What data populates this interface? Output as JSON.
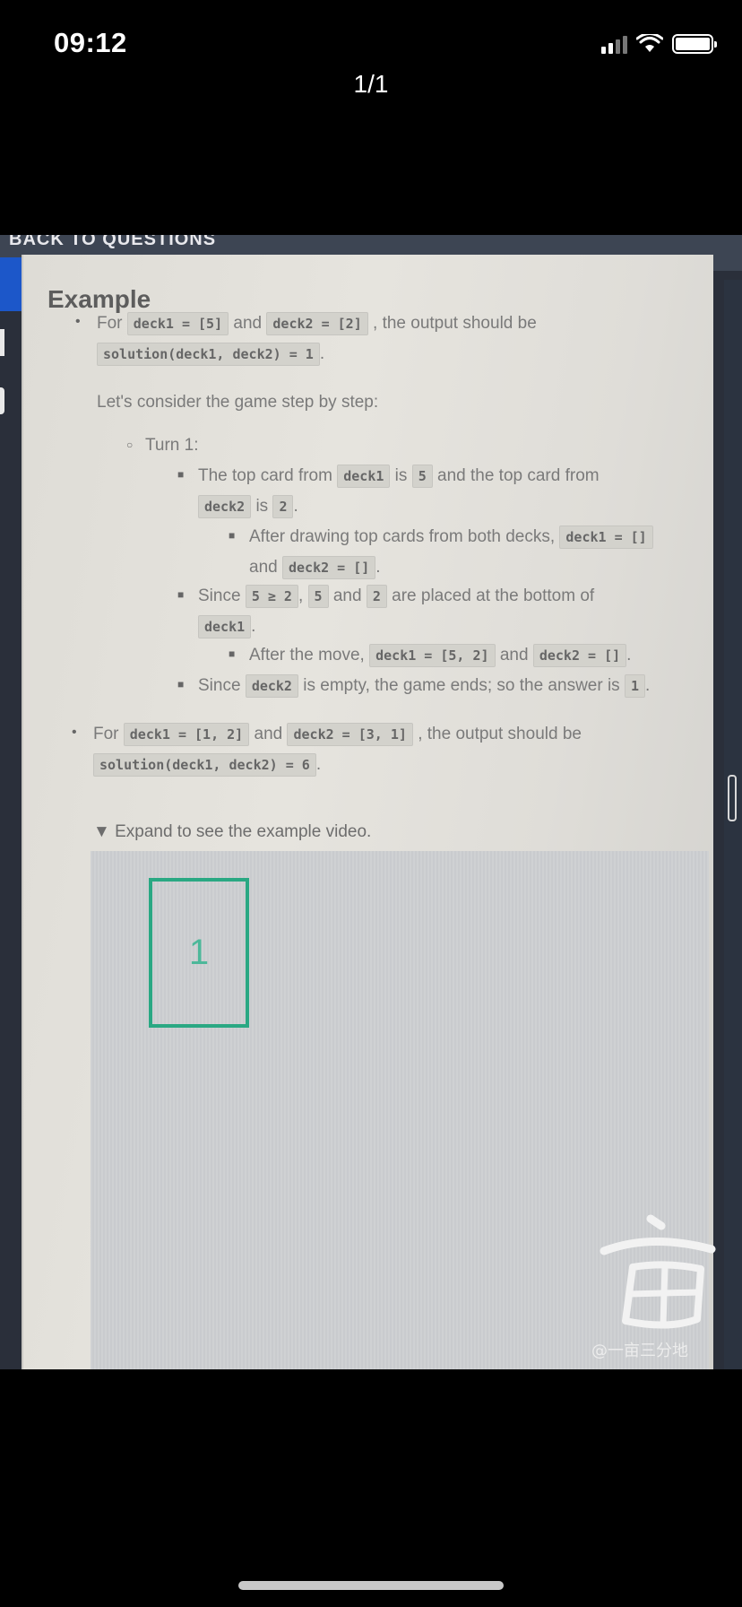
{
  "status_bar": {
    "time": "09:12"
  },
  "viewer": {
    "page_counter": "1/1"
  },
  "section": {
    "cut_heading": "BACK TO QUESTIONS"
  },
  "example": {
    "heading": "Example",
    "ex1": {
      "for": "For",
      "deck1_code": "deck1 = [5]",
      "and": "and",
      "deck2_code": "deck2 = [2]",
      "output_text": ", the output should be",
      "solution_code": "solution(deck1, deck2) = 1",
      "period": "."
    },
    "intro": "Let's consider the game step by step:",
    "turn_label": "Turn 1:",
    "step1": {
      "text_a": "The top card from",
      "deck1": "deck1",
      "is1": "is",
      "val5": "5",
      "text_b": "and the top card from",
      "deck2": "deck2",
      "is2": "is",
      "val2": "2",
      "period": "."
    },
    "step1_sub": {
      "text": "After drawing top cards from both decks,",
      "deck1_empty": "deck1 = []",
      "and": "and",
      "deck2_empty": "deck2 = []",
      "period": "."
    },
    "step2": {
      "since": "Since",
      "cmp": "5 ≥ 2",
      "comma": ",",
      "val5": "5",
      "and": "and",
      "val2": "2",
      "text": "are placed at the bottom of",
      "deck1": "deck1",
      "period": "."
    },
    "step2_sub": {
      "text": "After the move,",
      "deck1_code": "deck1 = [5, 2]",
      "and": "and",
      "deck2_code": "deck2 = []",
      "period": "."
    },
    "step3": {
      "since": "Since",
      "deck2": "deck2",
      "text": "is empty, the game ends; so the answer is",
      "answer": "1",
      "period": "."
    },
    "ex2": {
      "for": "For",
      "deck1_code": "deck1 = [1, 2]",
      "and": "and",
      "deck2_code": "deck2 = [3, 1]",
      "output_text": ", the output should be",
      "solution_code": "solution(deck1, deck2) = 6",
      "period": "."
    },
    "details_label": "▼ Expand to see the example video.",
    "video_card_value": "1"
  },
  "watermark": {
    "text": "@一亩三分地"
  }
}
